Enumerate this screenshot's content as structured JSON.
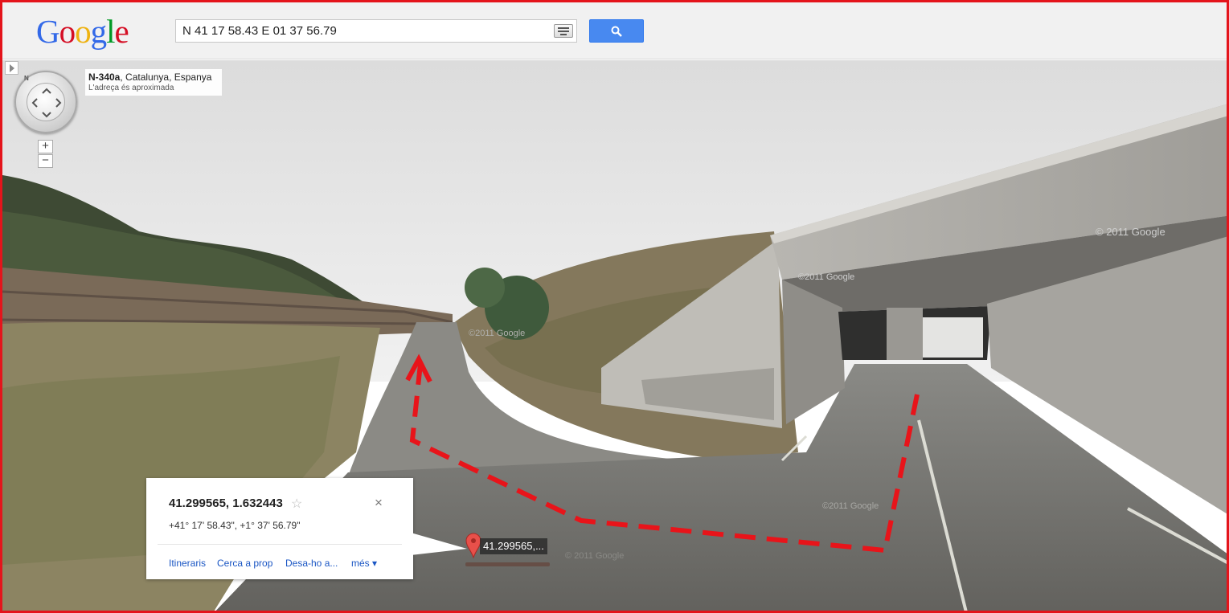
{
  "search": {
    "query": "N 41 17 58.43 E 01 37 56.79",
    "logo": [
      "G",
      "o",
      "o",
      "g",
      "l",
      "e"
    ],
    "logo_colors": [
      "#3369e8",
      "#d50f25",
      "#eeb211",
      "#3369e8",
      "#009925",
      "#d50f25"
    ]
  },
  "address": {
    "road": "N-340a",
    "region": ", Catalunya, Espanya",
    "note": "L'adreça és aproximada"
  },
  "compass": {
    "north_label": "N"
  },
  "zoom": {
    "in_label": "+",
    "out_label": "−"
  },
  "info_bubble": {
    "coords": "41.299565, 1.632443",
    "star": "☆",
    "close": "×",
    "dms": "+41° 17' 58.43\", +1° 37' 56.79\"",
    "links": [
      "Itineraris",
      "Cerca a prop",
      "Desa-ho a...",
      "més ▾"
    ]
  },
  "marker": {
    "label": "41.299565,..."
  },
  "watermarks": [
    "© 2011 Google",
    "©2011 Google",
    "©2011 Google",
    "© 2011 Google",
    "©2011 Google"
  ],
  "colors": {
    "route_overlay": "#e8141a",
    "frame": "#e4141b",
    "search_button": "#4889f0"
  }
}
